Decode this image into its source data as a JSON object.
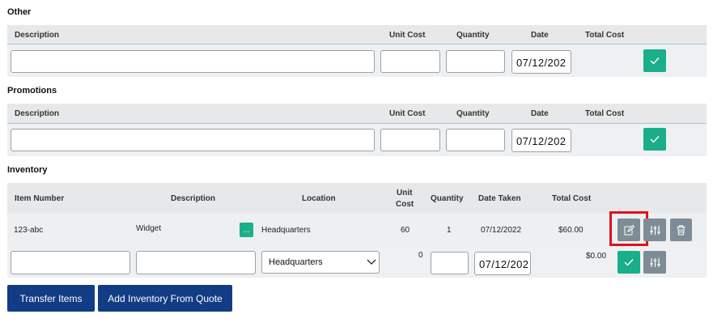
{
  "other": {
    "title": "Other",
    "headers": {
      "description": "Description",
      "unit_cost": "Unit Cost",
      "quantity": "Quantity",
      "date": "Date",
      "total_cost": "Total Cost"
    },
    "description_value": "",
    "unit_cost_value": "",
    "quantity_value": "",
    "date_value": "07/12/202"
  },
  "promotions": {
    "title": "Promotions",
    "headers": {
      "description": "Description",
      "unit_cost": "Unit Cost",
      "quantity": "Quantity",
      "date": "Date",
      "total_cost": "Total Cost"
    },
    "description_value": "",
    "unit_cost_value": "",
    "quantity_value": "",
    "date_value": "07/12/202"
  },
  "inventory": {
    "title": "Inventory",
    "headers": {
      "item_number": "Item Number",
      "description": "Description",
      "location": "Location",
      "unit_cost_line1": "Unit",
      "unit_cost_line2": "Cost",
      "quantity": "Quantity",
      "date_taken": "Date Taken",
      "total_cost": "Total Cost"
    },
    "row": {
      "item_number": "123-abc",
      "description": "Widget",
      "browse_label": "...",
      "location": "Headquarters",
      "unit_cost": "60",
      "quantity": "1",
      "date_taken": "07/12/2022",
      "total_cost": "$60.00"
    },
    "new_row": {
      "item_number_value": "",
      "description_value": "",
      "location_selected": "Headquarters",
      "unit_cost": "0",
      "quantity_value": "",
      "date_value": "07/12/202",
      "total_cost": "$0.00"
    },
    "highlight_color": "#e0121c"
  },
  "actions": {
    "transfer_items": "Transfer Items",
    "add_from_quote": "Add Inventory From Quote"
  },
  "colors": {
    "accent_green": "#1aae8a",
    "button_gray": "#7d8c96",
    "primary_blue": "#123c84"
  }
}
